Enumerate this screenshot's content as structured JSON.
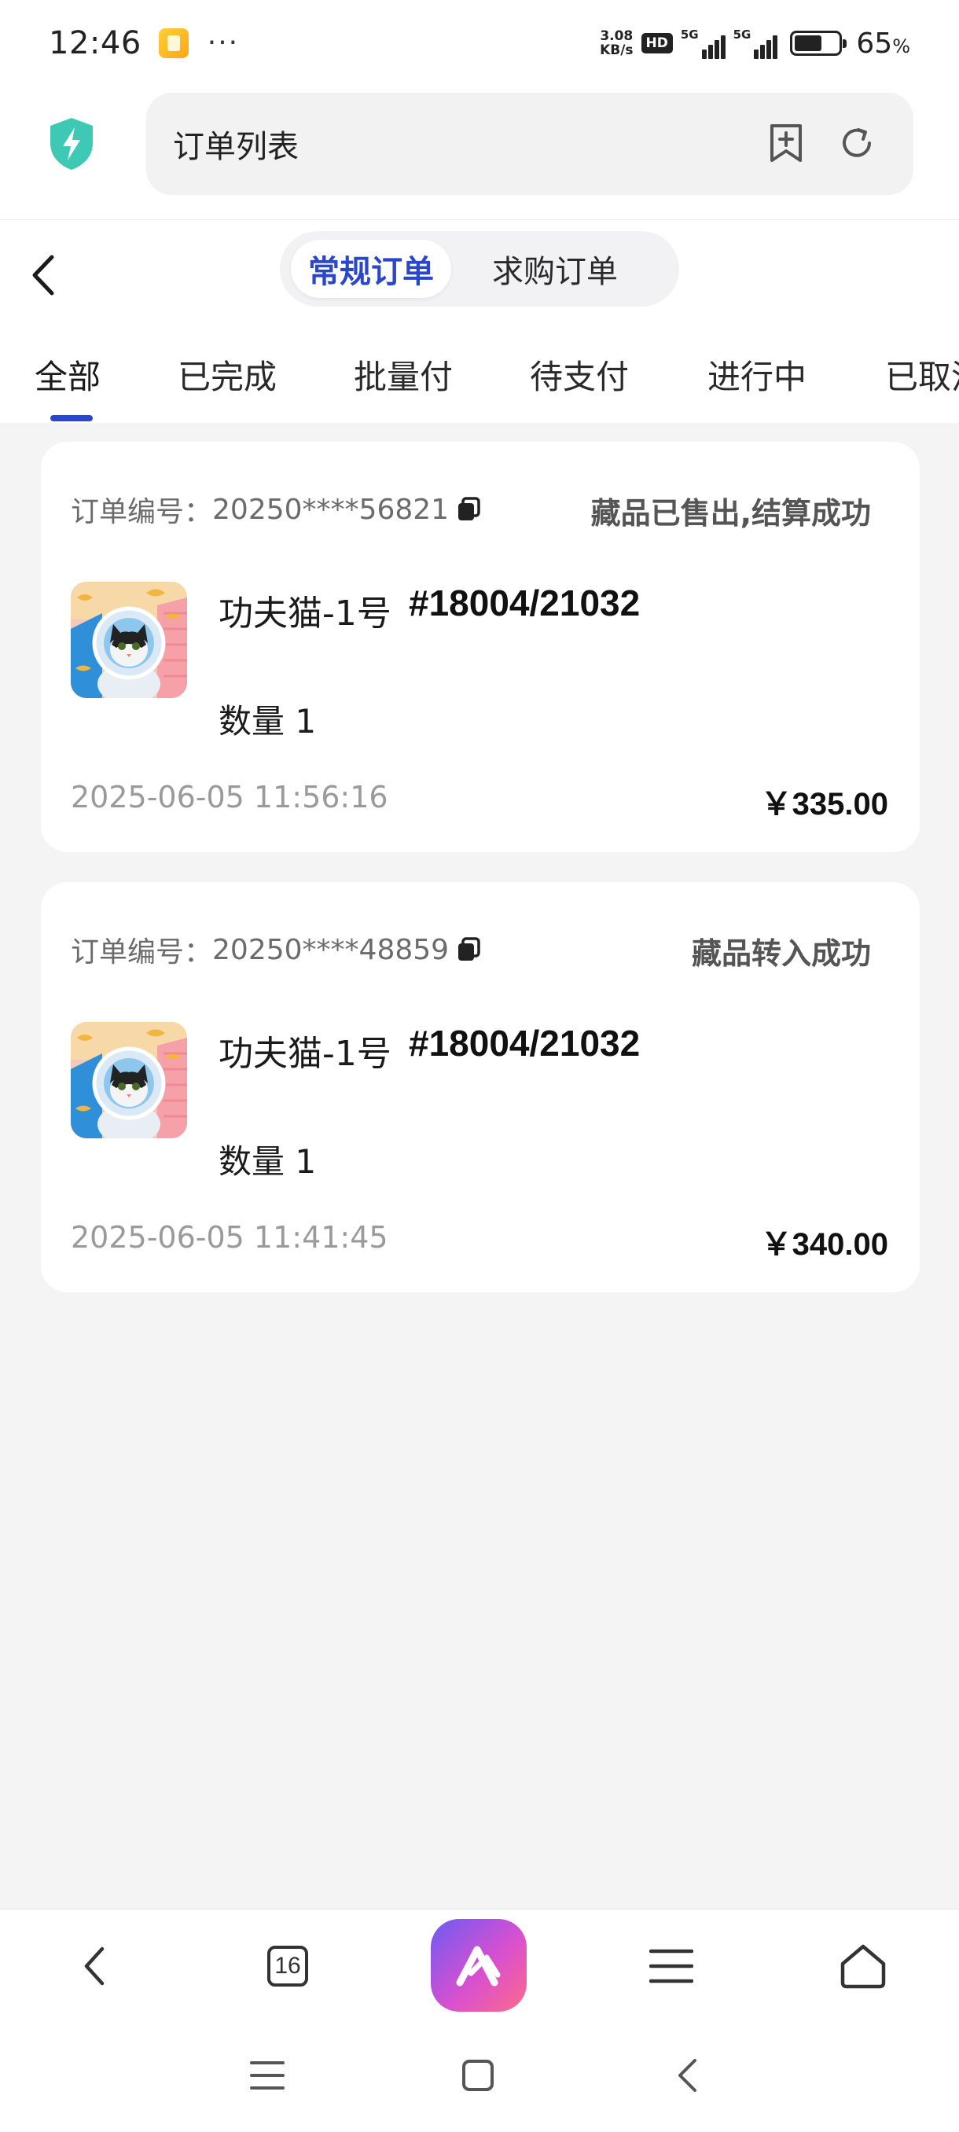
{
  "status_bar": {
    "time": "12:46",
    "dots": "···",
    "net_speed_value": "3.08",
    "net_speed_unit": "KB/s",
    "hd_label": "HD",
    "net1_label": "5G",
    "net2_label": "5G",
    "battery_percent": "65",
    "battery_unit": "%"
  },
  "browser": {
    "page_title": "订单列表",
    "tab_count": "16"
  },
  "segment": {
    "active": "常规订单",
    "inactive": "求购订单"
  },
  "tabs": [
    "全部",
    "已完成",
    "批量付",
    "待支付",
    "进行中",
    "已取消"
  ],
  "orders": [
    {
      "order_label": "订单编号：",
      "order_no": "20250****56821",
      "status": "藏品已售出,结算成功",
      "name": "功夫猫-1号",
      "serial": "#18004/21032",
      "qty": "数量 1",
      "time": "2025-06-05 11:56:16",
      "price": "￥335.00"
    },
    {
      "order_label": "订单编号：",
      "order_no": "20250****48859",
      "status": "藏品转入成功",
      "name": "功夫猫-1号",
      "serial": "#18004/21032",
      "qty": "数量 1",
      "time": "2025-06-05 11:41:45",
      "price": "￥340.00"
    }
  ],
  "colors": {
    "accent": "#2b47c9",
    "background": "#f4f4f5",
    "card": "#ffffff",
    "muted_text": "#9a9a9a",
    "shield": "#3ec9b4"
  },
  "icons": {
    "status_notification": "notification-icon",
    "shield": "shield-bolt-icon",
    "bookmark": "bookmark-add-icon",
    "refresh": "refresh-icon",
    "back": "chevron-left-icon",
    "copy": "copy-icon",
    "toolbar": [
      "chevron-left-icon",
      "tabs-icon",
      "ai-assistant-icon",
      "menu-icon",
      "home-icon"
    ],
    "system_nav": [
      "menu-icon",
      "home-square-icon",
      "back-icon"
    ]
  }
}
